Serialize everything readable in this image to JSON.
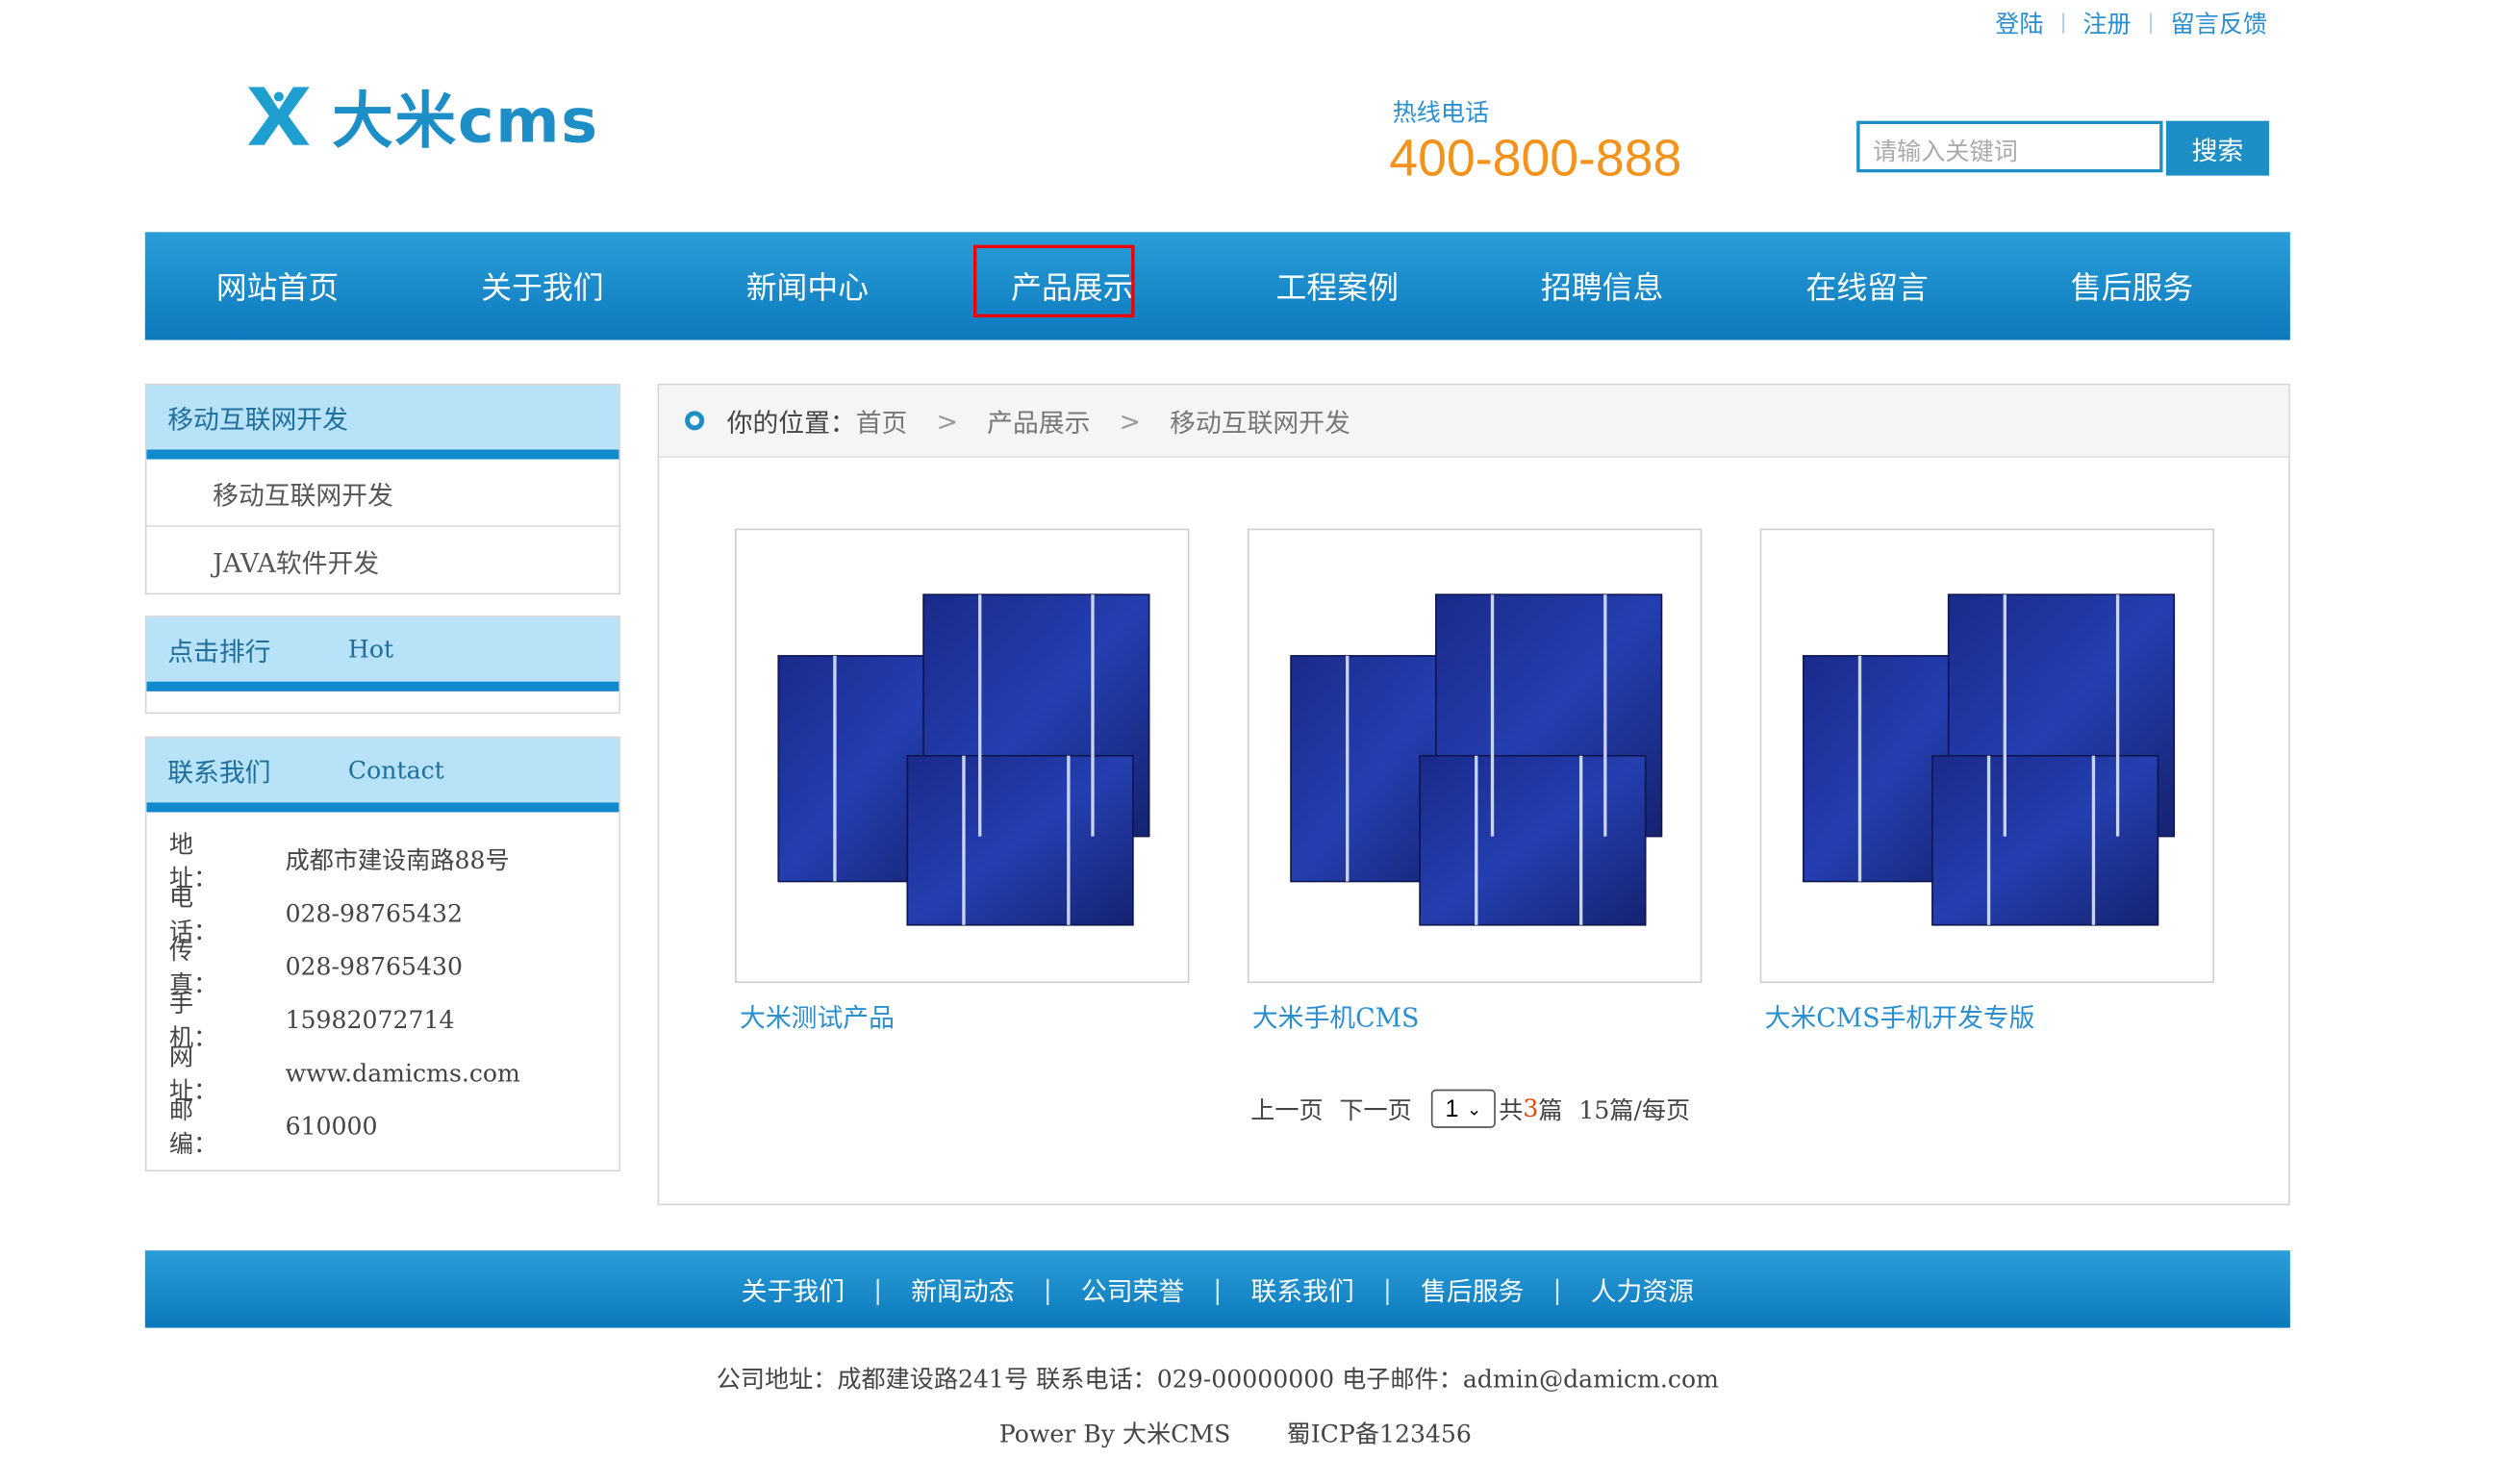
{
  "top_links": [
    "登陆",
    "注册",
    "留言反馈"
  ],
  "logo": {
    "text": "大米cms"
  },
  "hotline": {
    "label": "热线电话",
    "number": "400-800-888"
  },
  "search": {
    "placeholder": "请输入关键词",
    "button": "搜索"
  },
  "nav": [
    "网站首页",
    "关于我们",
    "新闻中心",
    "产品展示",
    "工程案例",
    "招聘信息",
    "在线留言",
    "售后服务"
  ],
  "nav_active_index": 3,
  "sidebar": {
    "category": {
      "title": "移动互联网开发",
      "items": [
        "移动互联网开发",
        "JAVA软件开发"
      ]
    },
    "hot": {
      "title": "点击排行",
      "en": "Hot"
    },
    "contact": {
      "title": "联系我们",
      "en": "Contact",
      "rows": [
        {
          "k": "地　　址：",
          "v": "成都市建设南路88号"
        },
        {
          "k": "电　　话：",
          "v": "028-98765432"
        },
        {
          "k": "传　　真：",
          "v": "028-98765430"
        },
        {
          "k": "手　　机：",
          "v": "15982072714"
        },
        {
          "k": "网　　址：",
          "v": "www.damicms.com"
        },
        {
          "k": "邮　　编：",
          "v": "610000"
        }
      ]
    }
  },
  "breadcrumb": {
    "label": "你的位置：",
    "items": [
      "首页",
      "产品展示",
      "移动互联网开发"
    ]
  },
  "products": [
    {
      "name": "大米测试产品",
      "image": "solar-panel-image"
    },
    {
      "name": "大米手机CMS",
      "image": "solar-panel-image"
    },
    {
      "name": "大米CMS手机开发专版",
      "image": "solar-panel-image"
    }
  ],
  "pager": {
    "prev": "上一页",
    "next": "下一页",
    "selected": "1",
    "total_prefix": "共",
    "total": "3",
    "total_suffix": "篇",
    "per_page": "15篇/每页"
  },
  "footer_nav": [
    "关于我们",
    "新闻动态",
    "公司荣誉",
    "联系我们",
    "售后服务",
    "人力资源"
  ],
  "footer": {
    "line1": "公司地址：成都建设路241号 联系电话：029-00000000 电子邮件：admin@damicm.com",
    "power": "Power By 大米CMS",
    "icp": "蜀ICP备123456"
  },
  "colors": {
    "brand": "#1e8fc6",
    "hotline": "#f3931c",
    "nav_highlight": "#ee0000",
    "sidebar_head": "#b8e2f7"
  }
}
